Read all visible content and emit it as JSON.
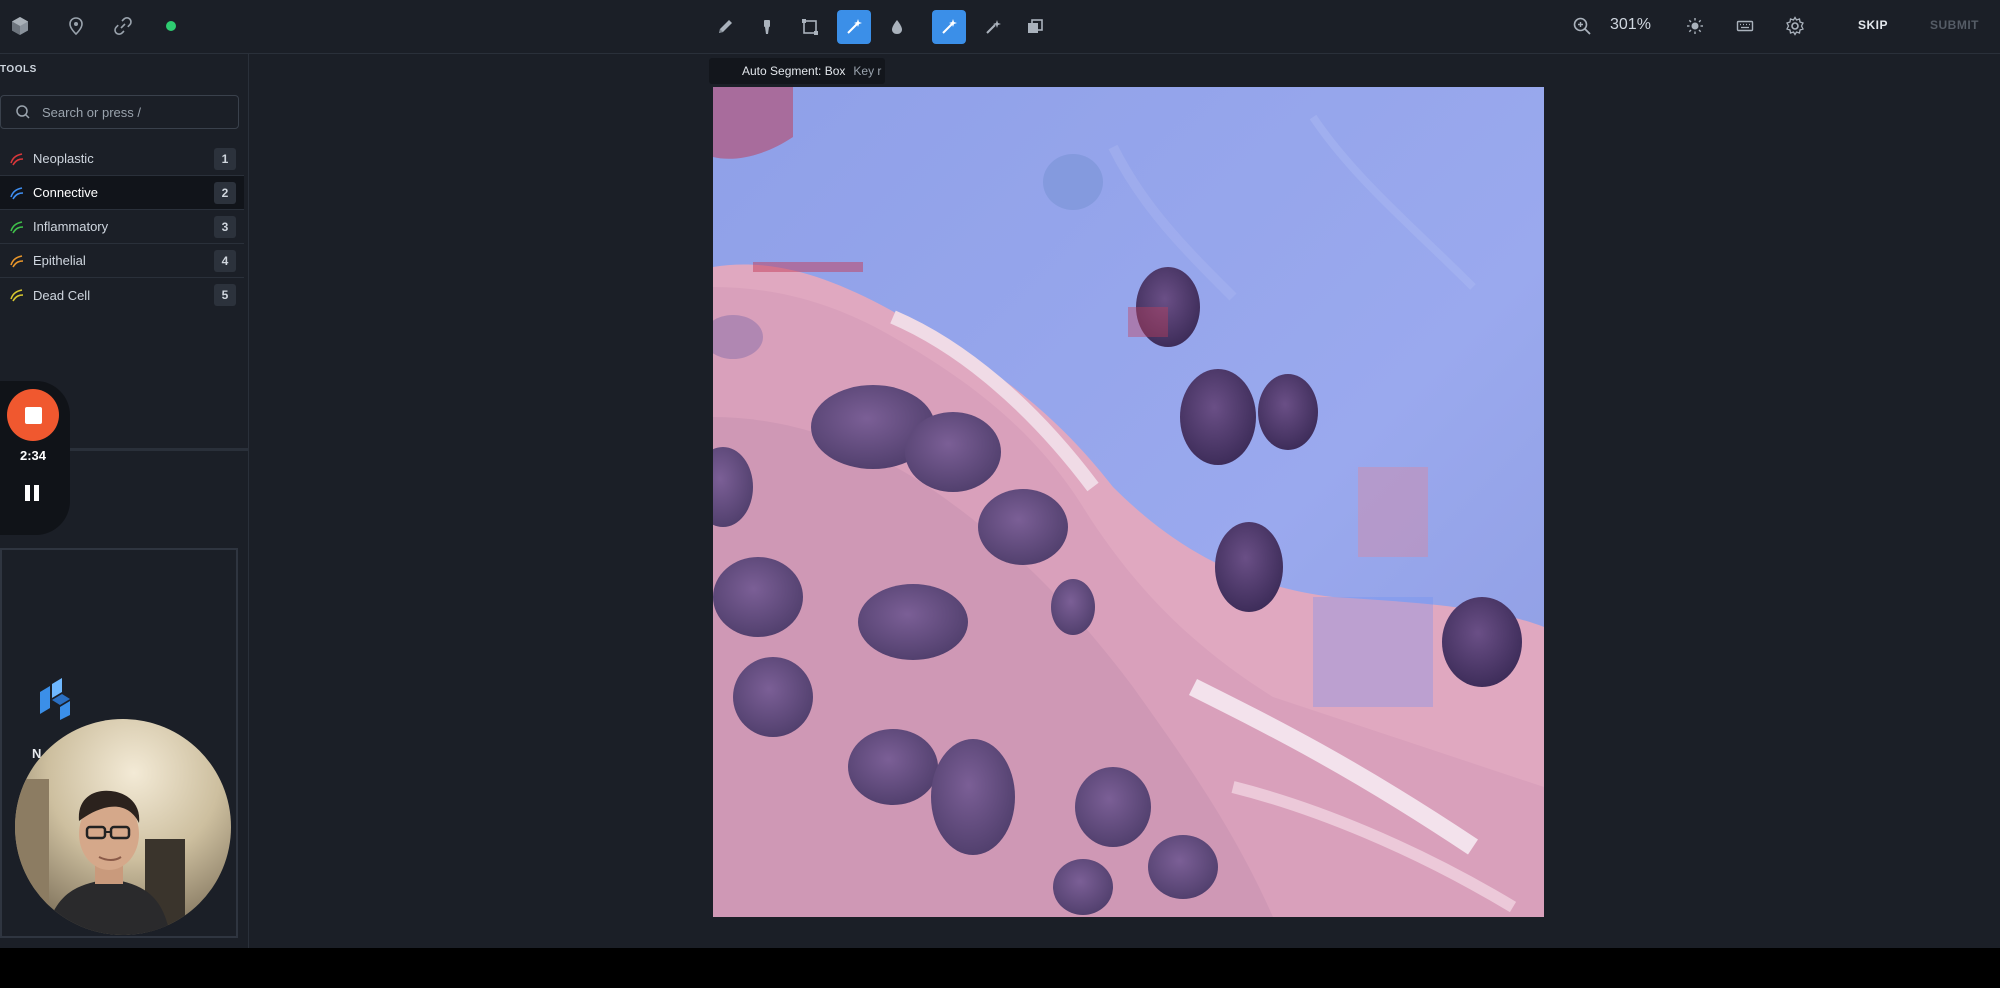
{
  "topbar": {
    "left_icons": [
      "app-logo-icon",
      "location-pin-icon",
      "link-icon",
      "status-dot-icon"
    ],
    "tools": [
      {
        "name": "pencil-icon",
        "active": false
      },
      {
        "name": "brush-icon",
        "active": false
      },
      {
        "name": "box-select-icon",
        "active": false
      },
      {
        "name": "auto-segment-icon",
        "active": true
      },
      {
        "name": "drop-icon",
        "active": false
      },
      {
        "name": "magic-wand-icon",
        "active": true
      },
      {
        "name": "wand-icon",
        "active": false
      },
      {
        "name": "layers-icon",
        "active": false
      }
    ],
    "zoom_level": "301%",
    "skip_label": "SKIP",
    "submit_label": "SUBMIT"
  },
  "tooltip": {
    "title": "Auto Segment: Box",
    "key": "Key r"
  },
  "sidebar": {
    "title": "TOOLS",
    "search_placeholder": "Search or press /",
    "classes": [
      {
        "label": "Neoplastic",
        "key": "1",
        "color": "#d9373a"
      },
      {
        "label": "Connective",
        "key": "2",
        "color": "#3f8ef0",
        "selected": true
      },
      {
        "label": "Inflammatory",
        "key": "3",
        "color": "#3fbf4a"
      },
      {
        "label": "Epithelial",
        "key": "4",
        "color": "#e8962b"
      },
      {
        "label": "Dead Cell",
        "key": "5",
        "color": "#d7c72f"
      }
    ]
  },
  "recorder": {
    "time": "2:34"
  },
  "preview": {
    "partial_text": "N"
  },
  "colors": {
    "accent": "#3b8fe8",
    "record": "#f0582f",
    "status_online": "#2ecc71",
    "background": "#1b1f27"
  }
}
